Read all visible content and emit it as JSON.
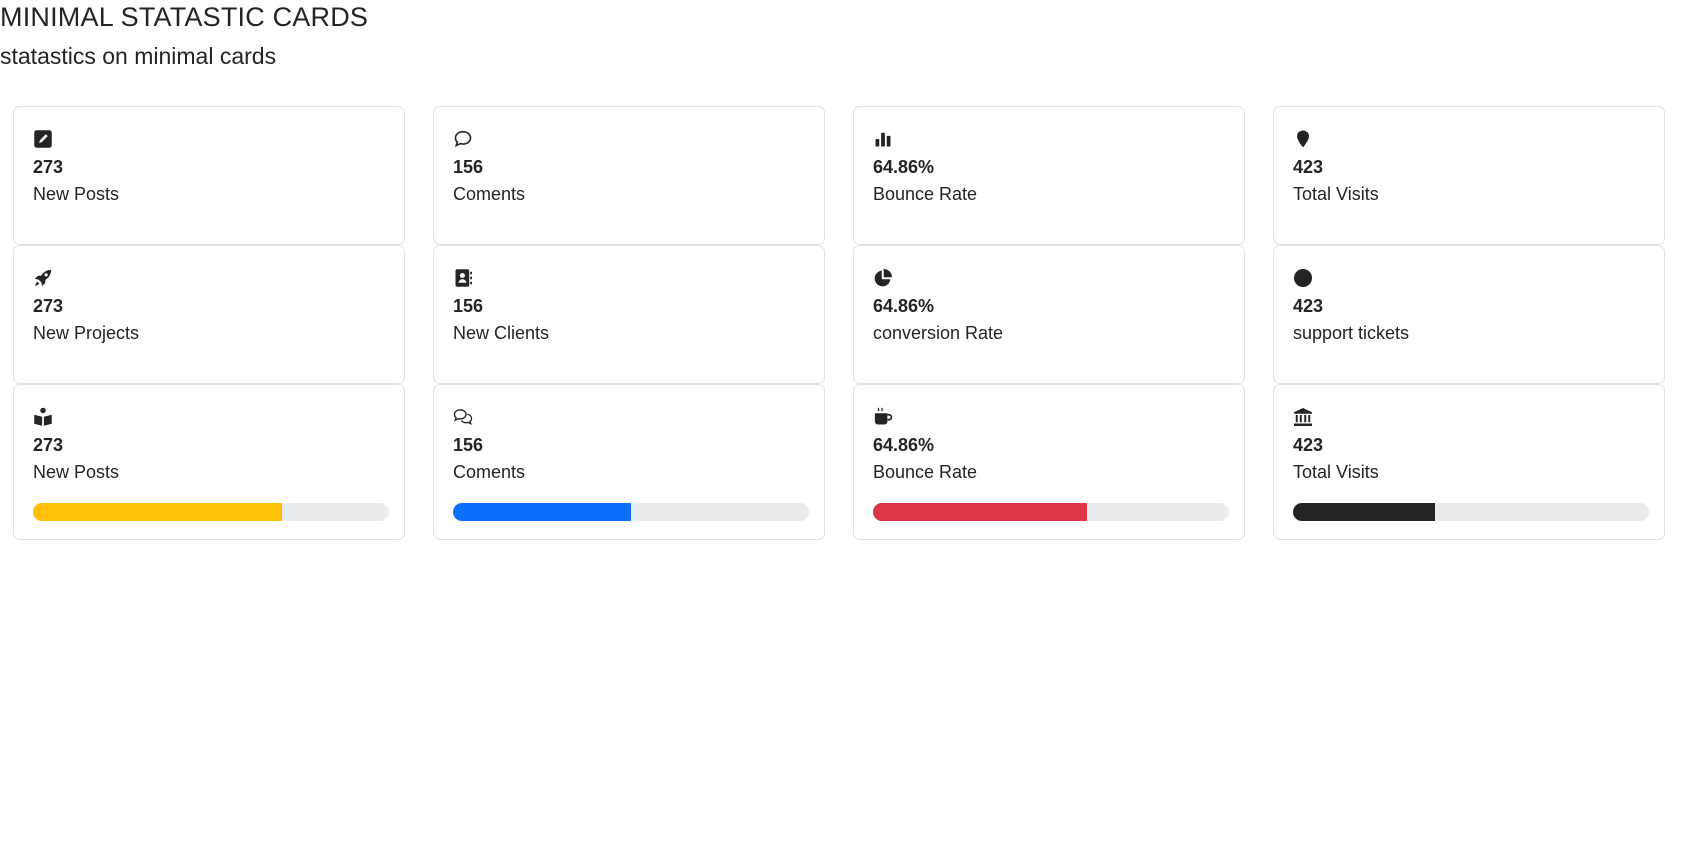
{
  "header": {
    "title": "MINIMAL STATASTIC CARDS",
    "subtitle": "statastics on minimal cards"
  },
  "rows": [
    [
      {
        "icon": "pencil-square-icon",
        "value": "273",
        "label": "New Posts"
      },
      {
        "icon": "chat-bubble-icon",
        "value": "156",
        "label": "Coments"
      },
      {
        "icon": "bar-chart-icon",
        "value": "64.86%",
        "label": "Bounce Rate"
      },
      {
        "icon": "map-pin-icon",
        "value": "423",
        "label": "Total Visits"
      }
    ],
    [
      {
        "icon": "rocket-icon",
        "value": "273",
        "label": "New Projects"
      },
      {
        "icon": "address-book-icon",
        "value": "156",
        "label": "New Clients"
      },
      {
        "icon": "pie-chart-icon",
        "value": "64.86%",
        "label": "conversion Rate"
      },
      {
        "icon": "circle-icon",
        "value": "423",
        "label": "support tickets"
      }
    ],
    [
      {
        "icon": "book-reader-icon",
        "value": "273",
        "label": "New Posts",
        "progress": 0.7,
        "color": "#ffc107"
      },
      {
        "icon": "chat-dots-icon",
        "value": "156",
        "label": "Coments",
        "progress": 0.5,
        "color": "#0d6efd"
      },
      {
        "icon": "coffee-cup-icon",
        "value": "64.86%",
        "label": "Bounce Rate",
        "progress": 0.6,
        "color": "#dc3545"
      },
      {
        "icon": "bank-icon",
        "value": "423",
        "label": "Total Visits",
        "progress": 0.4,
        "color": "#212529"
      }
    ]
  ]
}
